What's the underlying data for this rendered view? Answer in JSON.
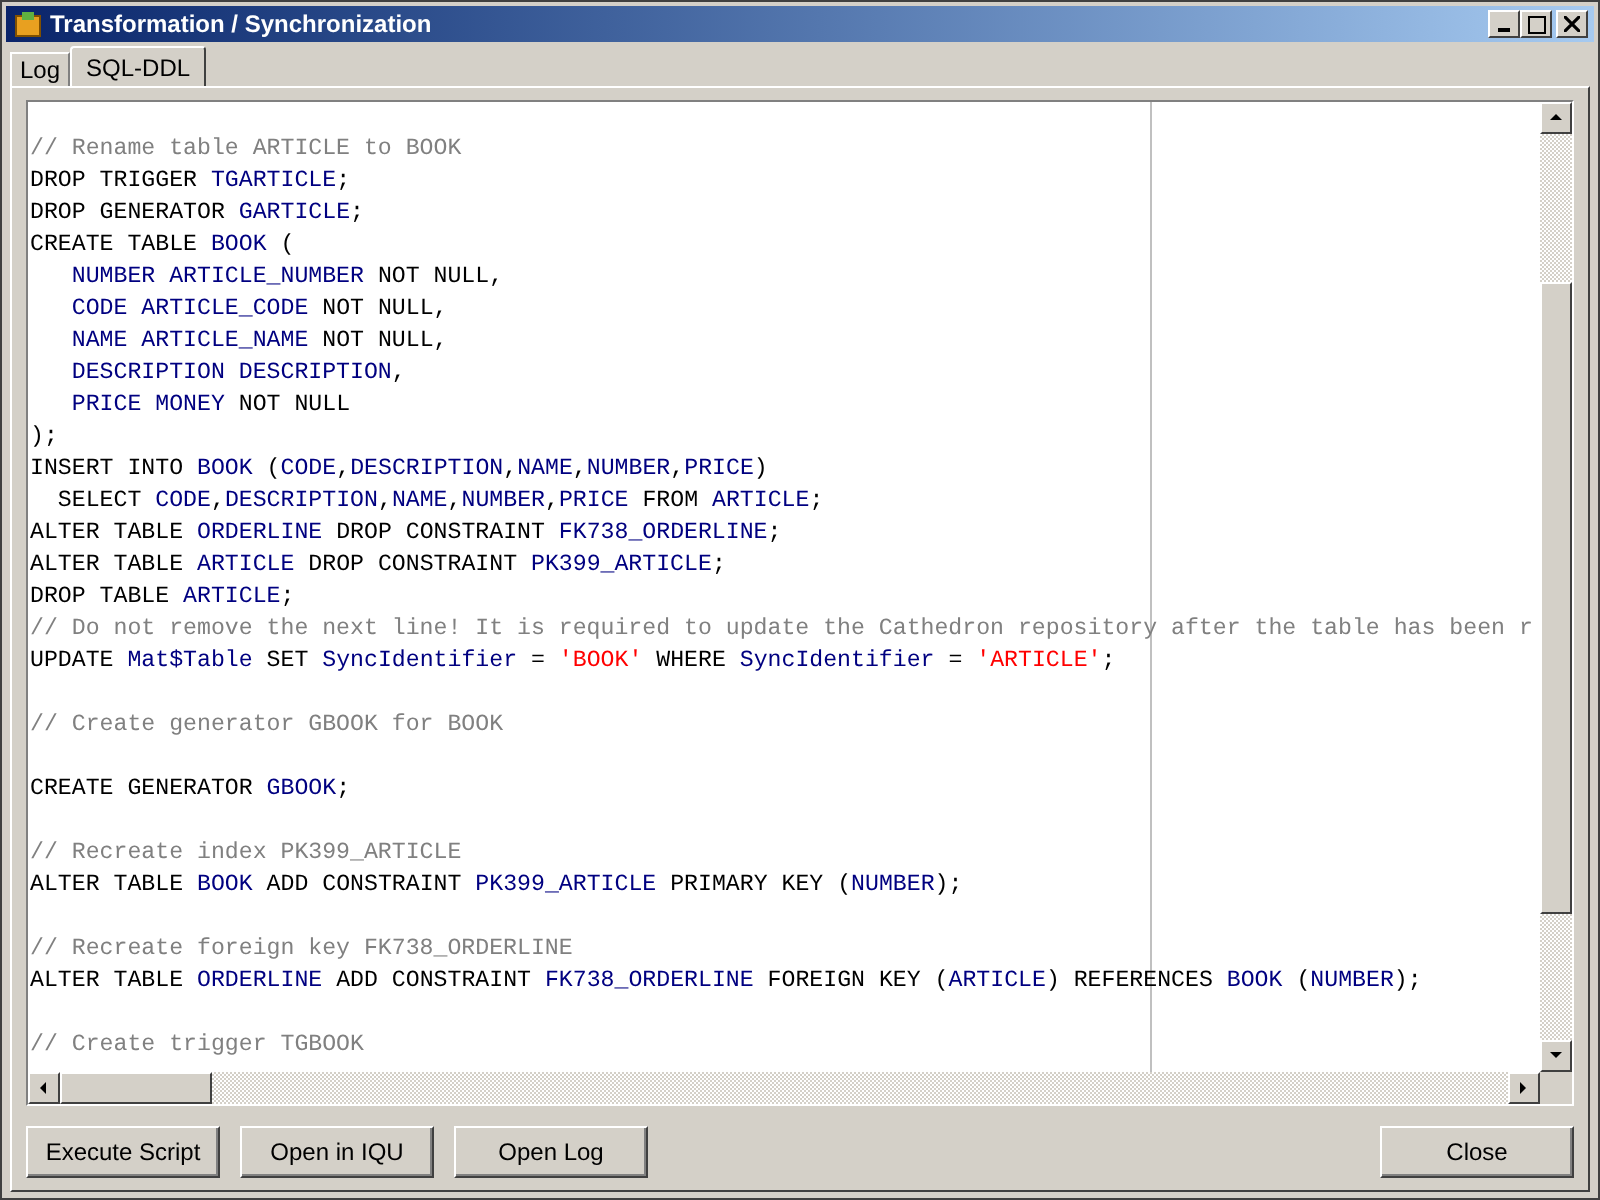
{
  "window": {
    "title": "Transformation / Synchronization"
  },
  "tabs": [
    {
      "label": "Log",
      "selected": false
    },
    {
      "label": "SQL-DDL",
      "selected": true
    }
  ],
  "editor": {
    "lines": [
      {
        "kind": "blank"
      },
      {
        "kind": "code",
        "tokens": [
          {
            "kind": "comment",
            "text": "// Rename table ARTICLE to BOOK"
          }
        ]
      },
      {
        "kind": "code",
        "tokens": [
          {
            "kind": "keyword",
            "text": "DROP TRIGGER "
          },
          {
            "kind": "ident",
            "text": "TGARTICLE"
          },
          {
            "kind": "keyword",
            "text": ";"
          }
        ]
      },
      {
        "kind": "code",
        "tokens": [
          {
            "kind": "keyword",
            "text": "DROP GENERATOR "
          },
          {
            "kind": "ident",
            "text": "GARTICLE"
          },
          {
            "kind": "keyword",
            "text": ";"
          }
        ]
      },
      {
        "kind": "code",
        "tokens": [
          {
            "kind": "keyword",
            "text": "CREATE TABLE "
          },
          {
            "kind": "ident",
            "text": "BOOK"
          },
          {
            "kind": "keyword",
            "text": " ("
          }
        ]
      },
      {
        "kind": "code",
        "tokens": [
          {
            "kind": "ident",
            "text": "   NUMBER ARTICLE_NUMBER"
          },
          {
            "kind": "keyword",
            "text": " NOT NULL,"
          }
        ]
      },
      {
        "kind": "code",
        "tokens": [
          {
            "kind": "ident",
            "text": "   CODE ARTICLE_CODE"
          },
          {
            "kind": "keyword",
            "text": " NOT NULL,"
          }
        ]
      },
      {
        "kind": "code",
        "tokens": [
          {
            "kind": "ident",
            "text": "   NAME ARTICLE_NAME"
          },
          {
            "kind": "keyword",
            "text": " NOT NULL,"
          }
        ]
      },
      {
        "kind": "code",
        "tokens": [
          {
            "kind": "ident",
            "text": "   DESCRIPTION DESCRIPTION"
          },
          {
            "kind": "keyword",
            "text": ","
          }
        ]
      },
      {
        "kind": "code",
        "tokens": [
          {
            "kind": "ident",
            "text": "   PRICE MONEY"
          },
          {
            "kind": "keyword",
            "text": " NOT NULL"
          }
        ]
      },
      {
        "kind": "code",
        "tokens": [
          {
            "kind": "keyword",
            "text": ");"
          }
        ]
      },
      {
        "kind": "code",
        "tokens": [
          {
            "kind": "keyword",
            "text": "INSERT INTO "
          },
          {
            "kind": "ident",
            "text": "BOOK"
          },
          {
            "kind": "keyword",
            "text": " ("
          },
          {
            "kind": "ident",
            "text": "CODE"
          },
          {
            "kind": "keyword",
            "text": ","
          },
          {
            "kind": "ident",
            "text": "DESCRIPTION"
          },
          {
            "kind": "keyword",
            "text": ","
          },
          {
            "kind": "ident",
            "text": "NAME"
          },
          {
            "kind": "keyword",
            "text": ","
          },
          {
            "kind": "ident",
            "text": "NUMBER"
          },
          {
            "kind": "keyword",
            "text": ","
          },
          {
            "kind": "ident",
            "text": "PRICE"
          },
          {
            "kind": "keyword",
            "text": ")"
          }
        ]
      },
      {
        "kind": "code",
        "tokens": [
          {
            "kind": "keyword",
            "text": "  SELECT "
          },
          {
            "kind": "ident",
            "text": "CODE"
          },
          {
            "kind": "keyword",
            "text": ","
          },
          {
            "kind": "ident",
            "text": "DESCRIPTION"
          },
          {
            "kind": "keyword",
            "text": ","
          },
          {
            "kind": "ident",
            "text": "NAME"
          },
          {
            "kind": "keyword",
            "text": ","
          },
          {
            "kind": "ident",
            "text": "NUMBER"
          },
          {
            "kind": "keyword",
            "text": ","
          },
          {
            "kind": "ident",
            "text": "PRICE"
          },
          {
            "kind": "keyword",
            "text": " FROM "
          },
          {
            "kind": "ident",
            "text": "ARTICLE"
          },
          {
            "kind": "keyword",
            "text": ";"
          }
        ]
      },
      {
        "kind": "code",
        "tokens": [
          {
            "kind": "keyword",
            "text": "ALTER TABLE "
          },
          {
            "kind": "ident",
            "text": "ORDERLINE"
          },
          {
            "kind": "keyword",
            "text": " DROP CONSTRAINT "
          },
          {
            "kind": "ident",
            "text": "FK738_ORDERLINE"
          },
          {
            "kind": "keyword",
            "text": ";"
          }
        ]
      },
      {
        "kind": "code",
        "tokens": [
          {
            "kind": "keyword",
            "text": "ALTER TABLE "
          },
          {
            "kind": "ident",
            "text": "ARTICLE"
          },
          {
            "kind": "keyword",
            "text": " DROP CONSTRAINT "
          },
          {
            "kind": "ident",
            "text": "PK399_ARTICLE"
          },
          {
            "kind": "keyword",
            "text": ";"
          }
        ]
      },
      {
        "kind": "code",
        "tokens": [
          {
            "kind": "keyword",
            "text": "DROP TABLE "
          },
          {
            "kind": "ident",
            "text": "ARTICLE"
          },
          {
            "kind": "keyword",
            "text": ";"
          }
        ]
      },
      {
        "kind": "code",
        "tokens": [
          {
            "kind": "comment",
            "text": "// Do not remove the next line! It is required to update the Cathedron repository after the table has been r"
          }
        ]
      },
      {
        "kind": "code",
        "tokens": [
          {
            "kind": "keyword",
            "text": "UPDATE "
          },
          {
            "kind": "ident",
            "text": "Mat$Table"
          },
          {
            "kind": "keyword",
            "text": " SET "
          },
          {
            "kind": "ident",
            "text": "SyncIdentifier"
          },
          {
            "kind": "keyword",
            "text": " = "
          },
          {
            "kind": "string",
            "text": "'BOOK'"
          },
          {
            "kind": "keyword",
            "text": " WHERE "
          },
          {
            "kind": "ident",
            "text": "SyncIdentifier"
          },
          {
            "kind": "keyword",
            "text": " = "
          },
          {
            "kind": "string",
            "text": "'ARTICLE'"
          },
          {
            "kind": "keyword",
            "text": ";"
          }
        ]
      },
      {
        "kind": "blank"
      },
      {
        "kind": "code",
        "tokens": [
          {
            "kind": "comment",
            "text": "// Create generator GBOOK for BOOK"
          }
        ]
      },
      {
        "kind": "blank"
      },
      {
        "kind": "code",
        "tokens": [
          {
            "kind": "keyword",
            "text": "CREATE GENERATOR "
          },
          {
            "kind": "ident",
            "text": "GBOOK"
          },
          {
            "kind": "keyword",
            "text": ";"
          }
        ]
      },
      {
        "kind": "blank"
      },
      {
        "kind": "code",
        "tokens": [
          {
            "kind": "comment",
            "text": "// Recreate index PK399_ARTICLE"
          }
        ]
      },
      {
        "kind": "code",
        "tokens": [
          {
            "kind": "keyword",
            "text": "ALTER TABLE "
          },
          {
            "kind": "ident",
            "text": "BOOK"
          },
          {
            "kind": "keyword",
            "text": " ADD CONSTRAINT "
          },
          {
            "kind": "ident",
            "text": "PK399_ARTICLE"
          },
          {
            "kind": "keyword",
            "text": " PRIMARY KEY ("
          },
          {
            "kind": "ident",
            "text": "NUMBER"
          },
          {
            "kind": "keyword",
            "text": ");"
          }
        ]
      },
      {
        "kind": "blank"
      },
      {
        "kind": "code",
        "tokens": [
          {
            "kind": "comment",
            "text": "// Recreate foreign key FK738_ORDERLINE"
          }
        ]
      },
      {
        "kind": "code",
        "tokens": [
          {
            "kind": "keyword",
            "text": "ALTER TABLE "
          },
          {
            "kind": "ident",
            "text": "ORDERLINE"
          },
          {
            "kind": "keyword",
            "text": " ADD CONSTRAINT "
          },
          {
            "kind": "ident",
            "text": "FK738_ORDERLINE"
          },
          {
            "kind": "keyword",
            "text": " FOREIGN KEY ("
          },
          {
            "kind": "ident",
            "text": "ARTICLE"
          },
          {
            "kind": "keyword",
            "text": ") REFERENCES "
          },
          {
            "kind": "ident",
            "text": "BOOK"
          },
          {
            "kind": "keyword",
            "text": " ("
          },
          {
            "kind": "ident",
            "text": "NUMBER"
          },
          {
            "kind": "keyword",
            "text": ");"
          }
        ]
      },
      {
        "kind": "blank"
      },
      {
        "kind": "code",
        "tokens": [
          {
            "kind": "comment",
            "text": "// Create trigger TGBOOK"
          }
        ]
      }
    ]
  },
  "buttons_left": [
    "Execute Script",
    "Open in IQU",
    "Open Log"
  ],
  "button_right": "Close"
}
